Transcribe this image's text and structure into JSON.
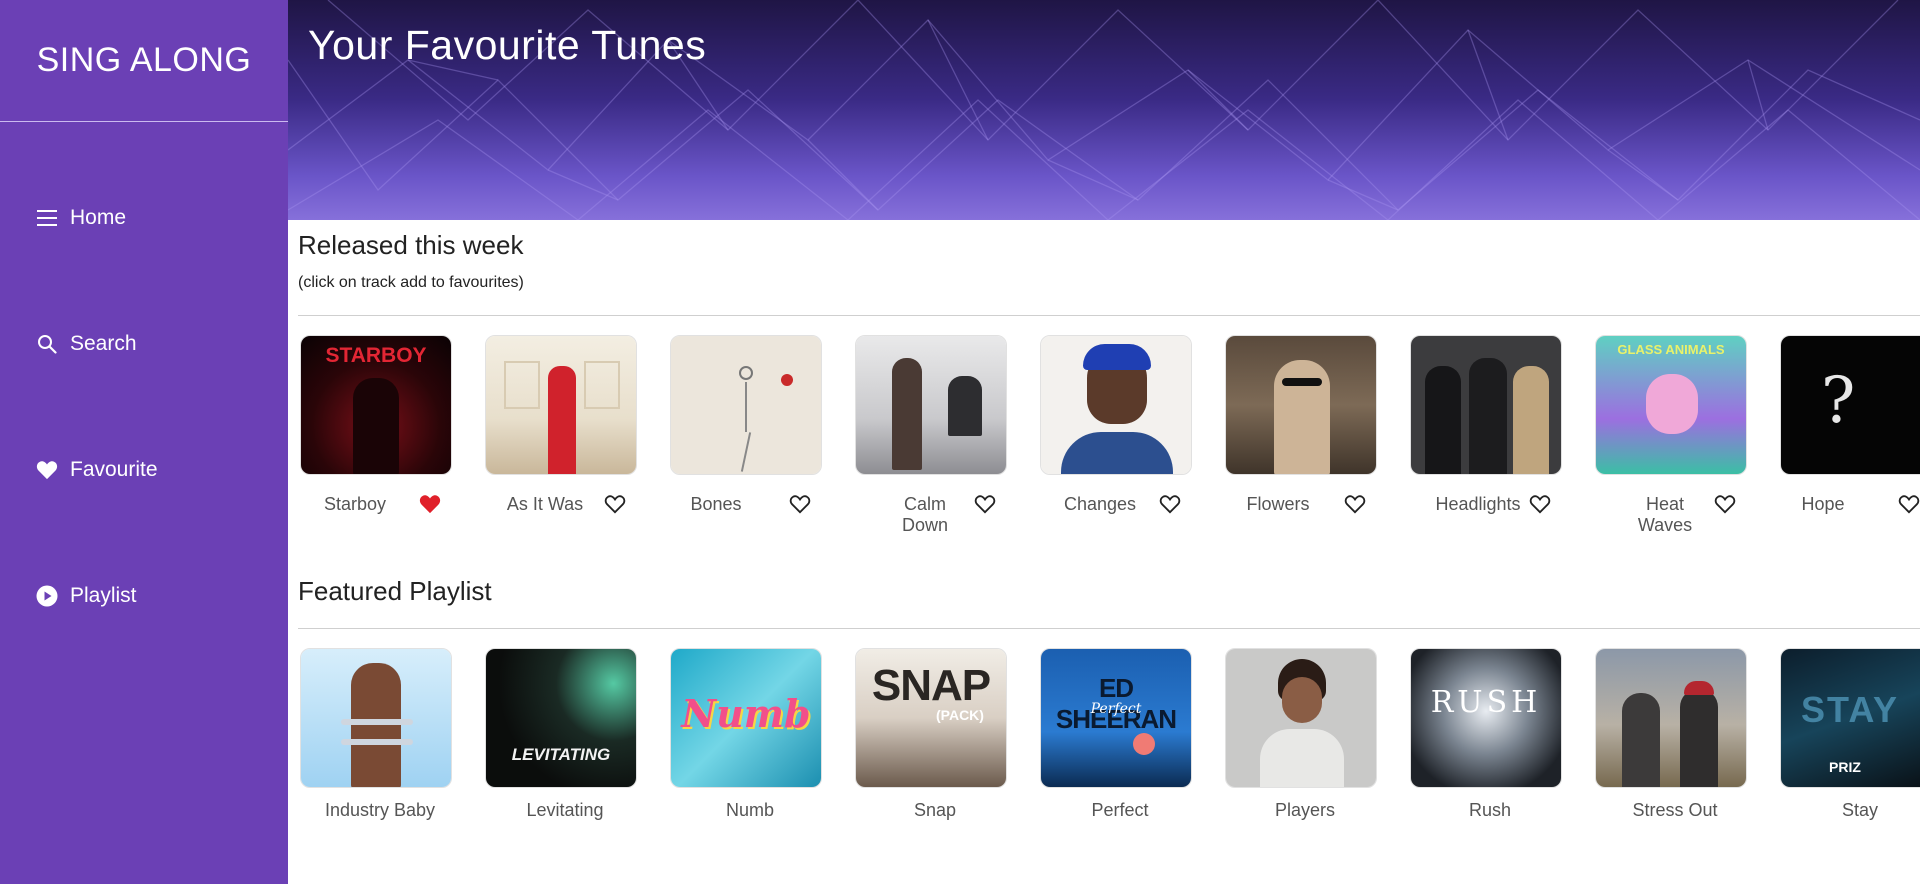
{
  "app": {
    "title": "SING ALONG"
  },
  "sidebar": {
    "items": [
      {
        "label": "Home",
        "icon": "menu-icon"
      },
      {
        "label": "Search",
        "icon": "search-icon"
      },
      {
        "label": "Favourite",
        "icon": "heart-icon"
      },
      {
        "label": "Playlist",
        "icon": "play-circle-icon"
      }
    ]
  },
  "banner": {
    "title": "Your Favourite Tunes"
  },
  "released": {
    "title": "Released this week",
    "subtitle": "(click on track add to favourites)",
    "tracks": [
      {
        "name": "Starboy",
        "favourite": true,
        "cover_text": "STARBOY"
      },
      {
        "name": "As It Was",
        "favourite": false
      },
      {
        "name": "Bones",
        "favourite": false
      },
      {
        "name": "Calm Down",
        "favourite": false
      },
      {
        "name": "Changes",
        "favourite": false
      },
      {
        "name": "Flowers",
        "favourite": false
      },
      {
        "name": "Headlights",
        "favourite": false
      },
      {
        "name": "Heat Waves",
        "favourite": false,
        "cover_text": "GLASS ANIMALS"
      },
      {
        "name": "Hope",
        "favourite": false,
        "cover_text": "?"
      }
    ]
  },
  "featured": {
    "title": "Featured Playlist",
    "playlists": [
      {
        "name": "Industry Baby"
      },
      {
        "name": "Levitating",
        "cover_text": "LEVITATING"
      },
      {
        "name": "Numb",
        "cover_text": "Numb"
      },
      {
        "name": "Snap",
        "cover_text": "SNAP",
        "cover_sub": "(PACK)"
      },
      {
        "name": "Perfect",
        "cover_text": "ED SHEERAN",
        "cover_sub": "Perfect"
      },
      {
        "name": "Players"
      },
      {
        "name": "Rush",
        "cover_text": "RUSH"
      },
      {
        "name": "Stress Out"
      },
      {
        "name": "Stay",
        "cover_text": "STAY",
        "cover_sub": "PRIZ"
      }
    ]
  },
  "colors": {
    "sidebar": "#6b40b5",
    "accent": "#e0202a",
    "banner_dark": "#1f1545",
    "banner_light": "#8670da"
  }
}
